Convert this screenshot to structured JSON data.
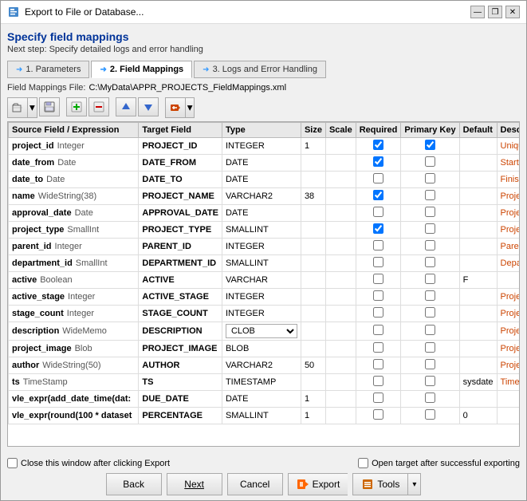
{
  "window": {
    "title": "Export to File or Database...",
    "minimize_label": "—",
    "restore_label": "❐",
    "close_label": "✕"
  },
  "heading": "Specify field mappings",
  "subheading": "Next step: Specify detailed logs and error handling",
  "tabs": [
    {
      "id": "parameters",
      "label": "1. Parameters",
      "active": false
    },
    {
      "id": "field-mappings",
      "label": "2. Field Mappings",
      "active": true
    },
    {
      "id": "logs",
      "label": "3. Logs and Error Handling",
      "active": false
    }
  ],
  "file_label": "Field Mappings File:",
  "file_path": "C:\\MyData\\APPR_PROJECTS_FieldMappings.xml",
  "toolbar": {
    "open_dropdown": "▾",
    "save": "💾",
    "add": "+",
    "delete": "✕",
    "move_up": "▲",
    "move_down": "▼",
    "import": "📥"
  },
  "table": {
    "headers": [
      "Source Field / Expression",
      "Target Field",
      "Type",
      "Size",
      "Scale",
      "Required",
      "Primary Key",
      "Default",
      "Description"
    ],
    "rows": [
      {
        "source": "project_id",
        "source_type": "Integer",
        "target": "PROJECT_ID",
        "type": "INTEGER",
        "size": "1",
        "scale": "",
        "required": true,
        "primary_key": true,
        "default": "",
        "description": "Unique project",
        "selected": false
      },
      {
        "source": "date_from",
        "source_type": "Date",
        "target": "DATE_FROM",
        "type": "DATE",
        "size": "",
        "scale": "",
        "required": true,
        "primary_key": false,
        "default": "",
        "description": "Start date",
        "selected": false
      },
      {
        "source": "date_to",
        "source_type": "Date",
        "target": "DATE_TO",
        "type": "DATE",
        "size": "",
        "scale": "",
        "required": false,
        "primary_key": false,
        "default": "",
        "description": "Finish date",
        "selected": false
      },
      {
        "source": "name",
        "source_type": "WideString(38)",
        "target": "PROJECT_NAME",
        "type": "VARCHAR2",
        "size": "38",
        "scale": "",
        "required": true,
        "primary_key": false,
        "default": "",
        "description": "Project name",
        "selected": false
      },
      {
        "source": "approval_date",
        "source_type": "Date",
        "target": "APPROVAL_DATE",
        "type": "DATE",
        "size": "",
        "scale": "",
        "required": false,
        "primary_key": false,
        "default": "",
        "description": "Project approv",
        "selected": false
      },
      {
        "source": "project_type",
        "source_type": "SmallInt",
        "target": "PROJECT_TYPE",
        "type": "SMALLINT",
        "size": "",
        "scale": "",
        "required": true,
        "primary_key": false,
        "default": "",
        "description": "Project type",
        "selected": false
      },
      {
        "source": "parent_id",
        "source_type": "Integer",
        "target": "PARENT_ID",
        "type": "INTEGER",
        "size": "",
        "scale": "",
        "required": false,
        "primary_key": false,
        "default": "",
        "description": "Parent project i",
        "selected": false
      },
      {
        "source": "department_id",
        "source_type": "SmallInt",
        "target": "DEPARTMENT_ID",
        "type": "SMALLINT",
        "size": "",
        "scale": "",
        "required": false,
        "primary_key": false,
        "default": "",
        "description": "Department id",
        "selected": false
      },
      {
        "source": "active",
        "source_type": "Boolean",
        "target": "ACTIVE",
        "type": "VARCHAR",
        "size": "",
        "scale": "",
        "required": false,
        "primary_key": false,
        "default": "F",
        "description": "",
        "selected": false
      },
      {
        "source": "active_stage",
        "source_type": "Integer",
        "target": "ACTIVE_STAGE",
        "type": "INTEGER",
        "size": "",
        "scale": "",
        "required": false,
        "primary_key": false,
        "default": "",
        "description": "Project stage ic",
        "selected": false
      },
      {
        "source": "stage_count",
        "source_type": "Integer",
        "target": "STAGE_COUNT",
        "type": "INTEGER",
        "size": "",
        "scale": "",
        "required": false,
        "primary_key": false,
        "default": "",
        "description": "Project stage c",
        "selected": false
      },
      {
        "source": "description",
        "source_type": "WideMemo",
        "target": "DESCRIPTION",
        "type": "CLOB",
        "size": "",
        "scale": "",
        "required": false,
        "primary_key": false,
        "default": "",
        "description": "Project descript",
        "selected": false,
        "has_dropdown": true
      },
      {
        "source": "project_image",
        "source_type": "Blob",
        "target": "PROJECT_IMAGE",
        "type": "BLOB",
        "size": "",
        "scale": "",
        "required": false,
        "primary_key": false,
        "default": "",
        "description": "Project present",
        "selected": false
      },
      {
        "source": "author",
        "source_type": "WideString(50)",
        "target": "AUTHOR",
        "type": "VARCHAR2",
        "size": "50",
        "scale": "",
        "required": false,
        "primary_key": false,
        "default": "",
        "description": "Project author",
        "selected": false
      },
      {
        "source": "ts",
        "source_type": "TimeStamp",
        "target": "TS",
        "type": "TIMESTAMP",
        "size": "",
        "scale": "",
        "required": false,
        "primary_key": false,
        "default": "sysdate",
        "description": "Timestamp of la",
        "selected": false
      },
      {
        "source": "vle_expr(add_date_time(dat:",
        "source_type": "",
        "target": "DUE_DATE",
        "type": "DATE",
        "size": "1",
        "scale": "",
        "required": false,
        "primary_key": false,
        "default": "",
        "description": "",
        "selected": false
      },
      {
        "source": "vle_expr(round(100 * dataset",
        "source_type": "",
        "target": "PERCENTAGE",
        "type": "SMALLINT",
        "size": "1",
        "scale": "",
        "required": false,
        "primary_key": false,
        "default": "0",
        "description": "",
        "selected": false
      }
    ]
  },
  "bottom": {
    "close_after_export_label": "Close this window after clicking Export",
    "open_after_export_label": "Open target after successful exporting",
    "back_label": "Back",
    "next_label": "Next",
    "cancel_label": "Cancel",
    "export_label": "Export",
    "tools_label": "Tools"
  }
}
